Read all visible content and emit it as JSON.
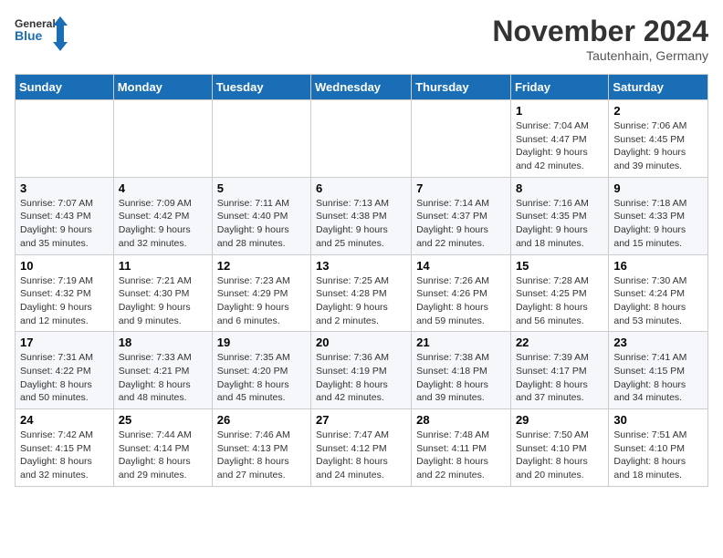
{
  "logo": {
    "text_general": "General",
    "text_blue": "Blue"
  },
  "header": {
    "month": "November 2024",
    "location": "Tautenhain, Germany"
  },
  "weekdays": [
    "Sunday",
    "Monday",
    "Tuesday",
    "Wednesday",
    "Thursday",
    "Friday",
    "Saturday"
  ],
  "weeks": [
    [
      {
        "day": "",
        "info": ""
      },
      {
        "day": "",
        "info": ""
      },
      {
        "day": "",
        "info": ""
      },
      {
        "day": "",
        "info": ""
      },
      {
        "day": "",
        "info": ""
      },
      {
        "day": "1",
        "info": "Sunrise: 7:04 AM\nSunset: 4:47 PM\nDaylight: 9 hours and 42 minutes."
      },
      {
        "day": "2",
        "info": "Sunrise: 7:06 AM\nSunset: 4:45 PM\nDaylight: 9 hours and 39 minutes."
      }
    ],
    [
      {
        "day": "3",
        "info": "Sunrise: 7:07 AM\nSunset: 4:43 PM\nDaylight: 9 hours and 35 minutes."
      },
      {
        "day": "4",
        "info": "Sunrise: 7:09 AM\nSunset: 4:42 PM\nDaylight: 9 hours and 32 minutes."
      },
      {
        "day": "5",
        "info": "Sunrise: 7:11 AM\nSunset: 4:40 PM\nDaylight: 9 hours and 28 minutes."
      },
      {
        "day": "6",
        "info": "Sunrise: 7:13 AM\nSunset: 4:38 PM\nDaylight: 9 hours and 25 minutes."
      },
      {
        "day": "7",
        "info": "Sunrise: 7:14 AM\nSunset: 4:37 PM\nDaylight: 9 hours and 22 minutes."
      },
      {
        "day": "8",
        "info": "Sunrise: 7:16 AM\nSunset: 4:35 PM\nDaylight: 9 hours and 18 minutes."
      },
      {
        "day": "9",
        "info": "Sunrise: 7:18 AM\nSunset: 4:33 PM\nDaylight: 9 hours and 15 minutes."
      }
    ],
    [
      {
        "day": "10",
        "info": "Sunrise: 7:19 AM\nSunset: 4:32 PM\nDaylight: 9 hours and 12 minutes."
      },
      {
        "day": "11",
        "info": "Sunrise: 7:21 AM\nSunset: 4:30 PM\nDaylight: 9 hours and 9 minutes."
      },
      {
        "day": "12",
        "info": "Sunrise: 7:23 AM\nSunset: 4:29 PM\nDaylight: 9 hours and 6 minutes."
      },
      {
        "day": "13",
        "info": "Sunrise: 7:25 AM\nSunset: 4:28 PM\nDaylight: 9 hours and 2 minutes."
      },
      {
        "day": "14",
        "info": "Sunrise: 7:26 AM\nSunset: 4:26 PM\nDaylight: 8 hours and 59 minutes."
      },
      {
        "day": "15",
        "info": "Sunrise: 7:28 AM\nSunset: 4:25 PM\nDaylight: 8 hours and 56 minutes."
      },
      {
        "day": "16",
        "info": "Sunrise: 7:30 AM\nSunset: 4:24 PM\nDaylight: 8 hours and 53 minutes."
      }
    ],
    [
      {
        "day": "17",
        "info": "Sunrise: 7:31 AM\nSunset: 4:22 PM\nDaylight: 8 hours and 50 minutes."
      },
      {
        "day": "18",
        "info": "Sunrise: 7:33 AM\nSunset: 4:21 PM\nDaylight: 8 hours and 48 minutes."
      },
      {
        "day": "19",
        "info": "Sunrise: 7:35 AM\nSunset: 4:20 PM\nDaylight: 8 hours and 45 minutes."
      },
      {
        "day": "20",
        "info": "Sunrise: 7:36 AM\nSunset: 4:19 PM\nDaylight: 8 hours and 42 minutes."
      },
      {
        "day": "21",
        "info": "Sunrise: 7:38 AM\nSunset: 4:18 PM\nDaylight: 8 hours and 39 minutes."
      },
      {
        "day": "22",
        "info": "Sunrise: 7:39 AM\nSunset: 4:17 PM\nDaylight: 8 hours and 37 minutes."
      },
      {
        "day": "23",
        "info": "Sunrise: 7:41 AM\nSunset: 4:15 PM\nDaylight: 8 hours and 34 minutes."
      }
    ],
    [
      {
        "day": "24",
        "info": "Sunrise: 7:42 AM\nSunset: 4:15 PM\nDaylight: 8 hours and 32 minutes."
      },
      {
        "day": "25",
        "info": "Sunrise: 7:44 AM\nSunset: 4:14 PM\nDaylight: 8 hours and 29 minutes."
      },
      {
        "day": "26",
        "info": "Sunrise: 7:46 AM\nSunset: 4:13 PM\nDaylight: 8 hours and 27 minutes."
      },
      {
        "day": "27",
        "info": "Sunrise: 7:47 AM\nSunset: 4:12 PM\nDaylight: 8 hours and 24 minutes."
      },
      {
        "day": "28",
        "info": "Sunrise: 7:48 AM\nSunset: 4:11 PM\nDaylight: 8 hours and 22 minutes."
      },
      {
        "day": "29",
        "info": "Sunrise: 7:50 AM\nSunset: 4:10 PM\nDaylight: 8 hours and 20 minutes."
      },
      {
        "day": "30",
        "info": "Sunrise: 7:51 AM\nSunset: 4:10 PM\nDaylight: 8 hours and 18 minutes."
      }
    ]
  ]
}
